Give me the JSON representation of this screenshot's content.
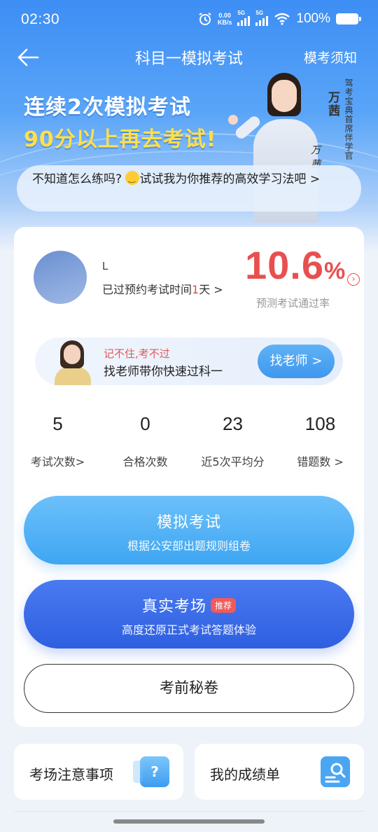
{
  "status_bar": {
    "time": "02:30",
    "net_speed_value": "0.00",
    "net_speed_unit": "KB/s",
    "signal1": "5G",
    "signal2": "5G",
    "battery": "100%"
  },
  "nav": {
    "title": "科目一模拟考试",
    "right_link": "模考须知"
  },
  "banner": {
    "headline1": "连续2次模拟考试",
    "headline2": "90分以上再去考试!",
    "tip_before": "不知道怎么练吗? ",
    "tip_after": "试试我为你推荐的高效学习法吧 >",
    "person_name": "万茜",
    "person_title": "驾考宝典首席伴学官",
    "signature": "万茜"
  },
  "user": {
    "name": "L",
    "exam_time_prefix": "已过预约考试时间",
    "exam_days": "1",
    "exam_time_suffix": "天 >",
    "pass_rate_value": "10.6",
    "pass_rate_unit": "%",
    "pass_rate_label": "预测考试通过率"
  },
  "teacher": {
    "line1": "记不住,考不过",
    "line2": "找老师带你快速过科一",
    "button": "找老师 >"
  },
  "stats": [
    {
      "value": "5",
      "label": "考试次数>"
    },
    {
      "value": "0",
      "label": "合格次数"
    },
    {
      "value": "23",
      "label": "近5次平均分"
    },
    {
      "value": "108",
      "label": "错题数 >"
    }
  ],
  "actions": {
    "mock": {
      "title": "模拟考试",
      "subtitle": "根据公安部出题规则组卷"
    },
    "real": {
      "title": "真实考场",
      "badge": "推荐",
      "subtitle": "高度还原正式考试答题体验"
    },
    "secret": {
      "title": "考前秘卷"
    }
  },
  "tiles": [
    {
      "label": "考场注意事项",
      "icon": "question-doc-icon"
    },
    {
      "label": "我的成绩单",
      "icon": "search-doc-icon"
    }
  ],
  "colors": {
    "accent_blue": "#3d8ef5",
    "rate_red": "#e85050",
    "dark_button": "#2e5fe0",
    "headline_yellow": "#ffe04a"
  }
}
